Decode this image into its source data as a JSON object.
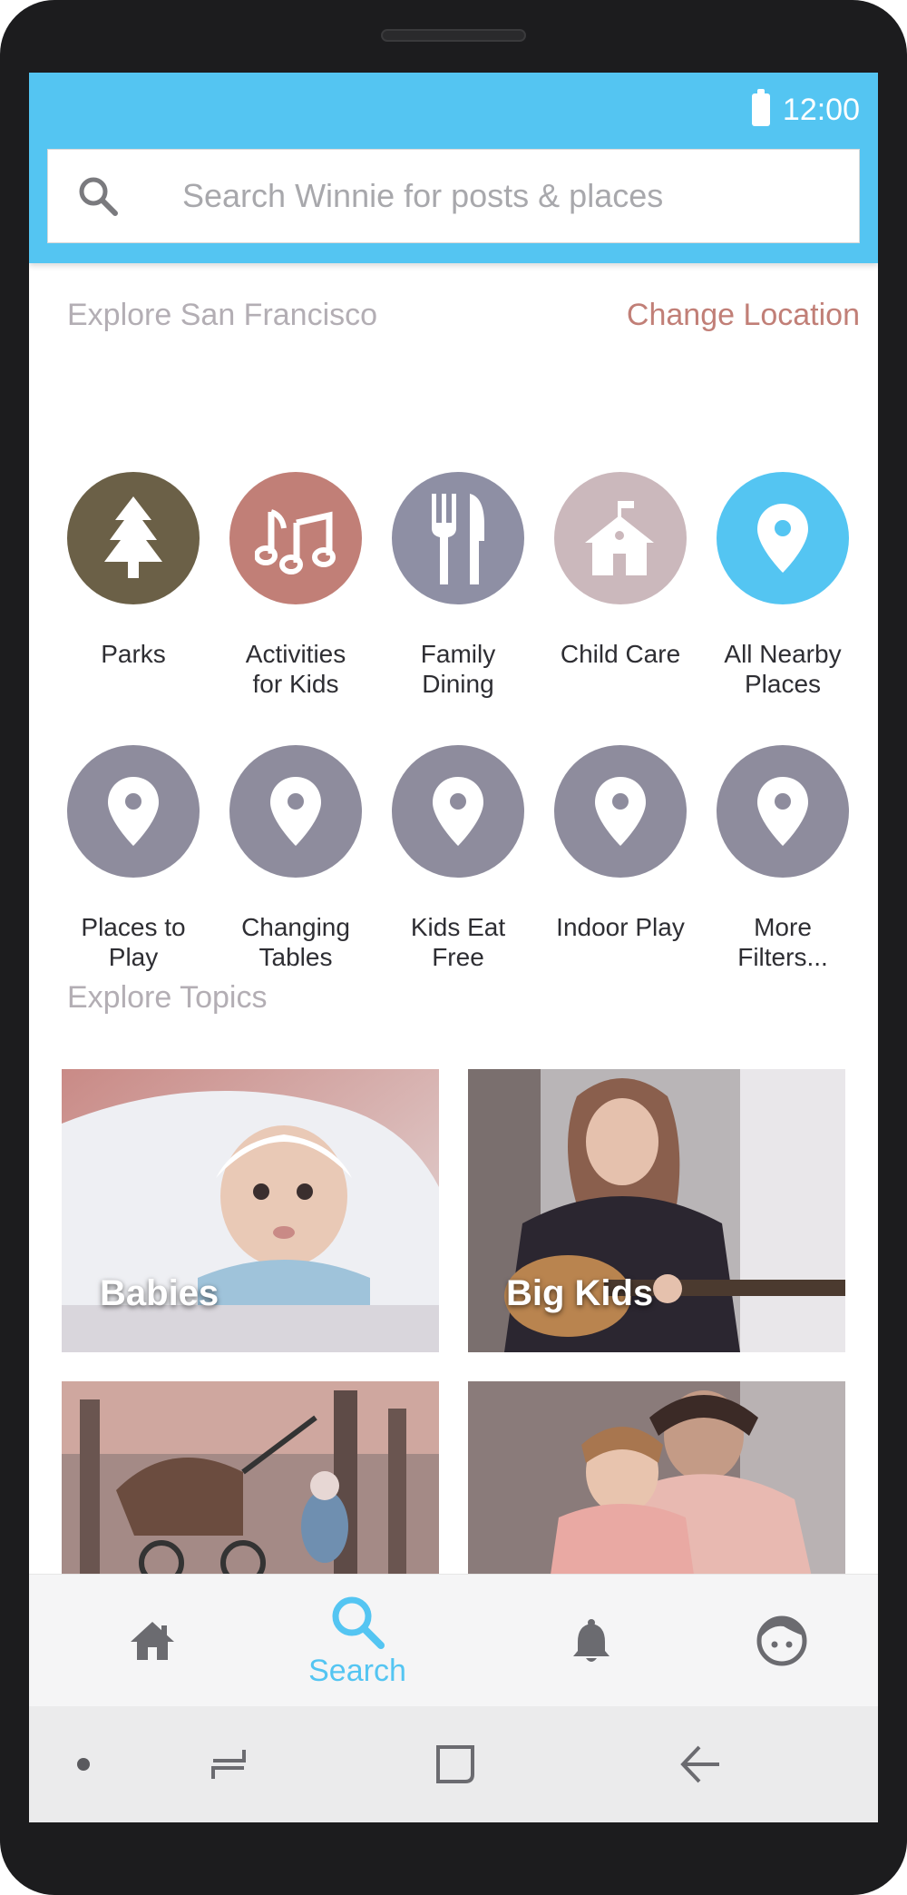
{
  "status": {
    "time": "12:00"
  },
  "search": {
    "placeholder": "Search Winnie for posts & places"
  },
  "explore": {
    "title": "Explore San Francisco",
    "change_location": "Change Location",
    "categories": [
      {
        "line1": "Parks",
        "line2": "",
        "icon": "tree-icon",
        "color": "#6b6047"
      },
      {
        "line1": "Activities",
        "line2": "for Kids",
        "icon": "music-notes-icon",
        "color": "#c17f77"
      },
      {
        "line1": "Family",
        "line2": "Dining",
        "icon": "fork-knife-icon",
        "color": "#8e8fa4"
      },
      {
        "line1": "Child Care",
        "line2": "",
        "icon": "schoolhouse-icon",
        "color": "#cbb8bc"
      },
      {
        "line1": "All Nearby",
        "line2": "Places",
        "icon": "location-pin-icon",
        "color": "#54c5f2"
      },
      {
        "line1": "Places to",
        "line2": "Play",
        "icon": "location-pin-icon",
        "color": "#8e8c9d"
      },
      {
        "line1": "Changing",
        "line2": "Tables",
        "icon": "location-pin-icon",
        "color": "#8e8c9d"
      },
      {
        "line1": "Kids Eat",
        "line2": "Free",
        "icon": "location-pin-icon",
        "color": "#8e8c9d"
      },
      {
        "line1": "Indoor Play",
        "line2": "",
        "icon": "location-pin-icon",
        "color": "#8e8c9d"
      },
      {
        "line1": "More",
        "line2": "Filters...",
        "icon": "location-pin-icon",
        "color": "#8e8c9d"
      }
    ]
  },
  "topics": {
    "title": "Explore Topics",
    "tiles": [
      {
        "label": "Babies"
      },
      {
        "label": "Big Kids"
      },
      {
        "label": ""
      },
      {
        "label": ""
      }
    ]
  },
  "nav": {
    "search_label": "Search",
    "active_color": "#54c5f2",
    "inactive_color": "#6b6b70"
  }
}
